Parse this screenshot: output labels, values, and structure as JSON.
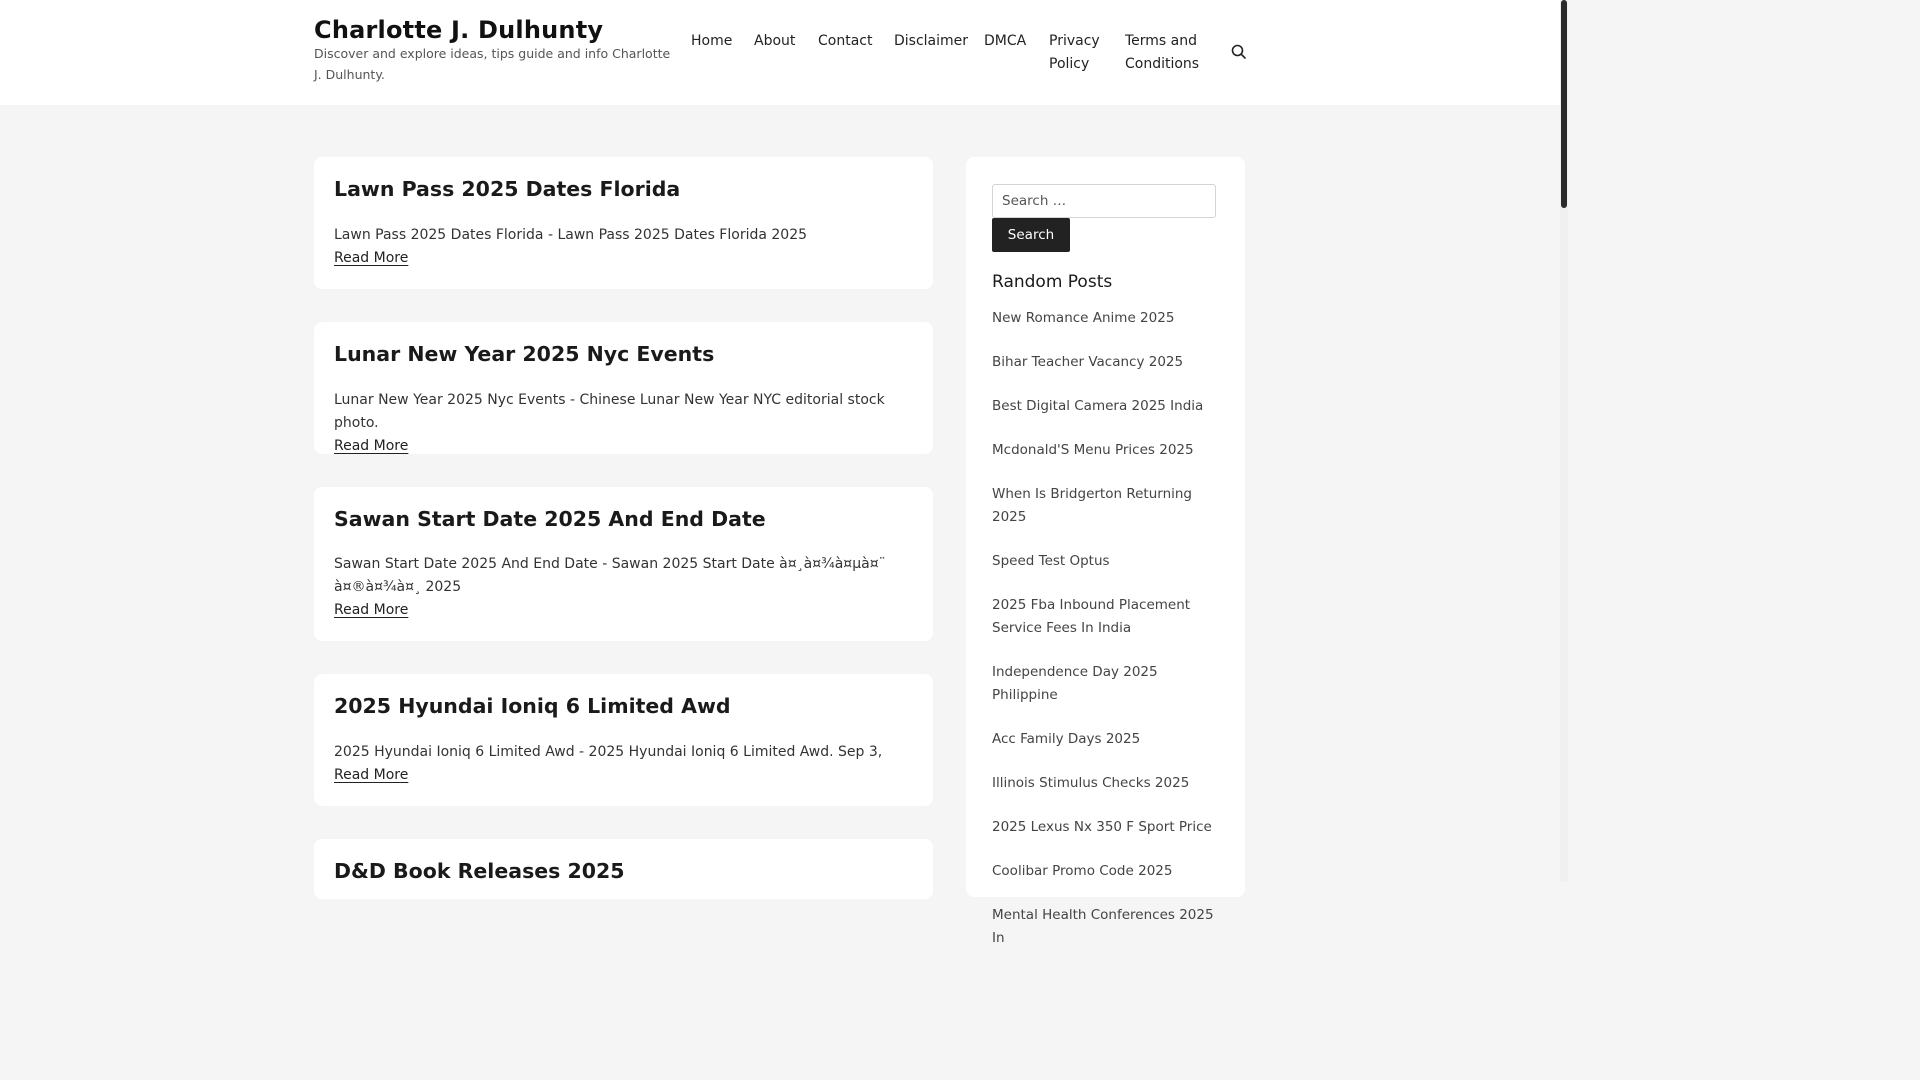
{
  "header": {
    "site_title": "Charlotte J. Dulhunty",
    "site_description": "Discover and explore ideas, tips guide and info Charlotte J. Dulhunty.",
    "nav": [
      "Home",
      "About",
      "Contact",
      "Disclaimer",
      "DMCA",
      "Privacy Policy",
      "Terms and Conditions"
    ],
    "search_icon": "search-icon"
  },
  "posts": [
    {
      "title": "Lawn Pass 2025 Dates Florida",
      "excerpt": "Lawn Pass 2025 Dates Florida - Lawn Pass 2025 Dates Florida 2025",
      "read_more": "Read More"
    },
    {
      "title": "Lunar New Year 2025 Nyc Events",
      "excerpt": "Lunar New Year 2025 Nyc Events - Chinese Lunar New Year NYC editorial stock photo.",
      "read_more": "Read More"
    },
    {
      "title": "Sawan Start Date 2025 And End Date",
      "excerpt": "Sawan Start Date 2025 And End Date - Sawan 2025 Start Date à¤¸à¤¾à¤µà¤¨ à¤®à¤¾à¤¸ 2025",
      "read_more": "Read More"
    },
    {
      "title": "2025 Hyundai Ioniq 6 Limited Awd",
      "excerpt": "2025 Hyundai Ioniq 6 Limited Awd - 2025 Hyundai Ioniq 6 Limited Awd. Sep 3,",
      "read_more": "Read More"
    },
    {
      "title": "D&D Book Releases 2025"
    }
  ],
  "sidebar": {
    "search_placeholder": "Search …",
    "search_button": "Search",
    "random_title": "Random Posts",
    "random_posts": [
      "New Romance Anime 2025",
      "Bihar Teacher Vacancy 2025",
      "Best Digital Camera 2025 India",
      "Mcdonald'S Menu Prices 2025",
      "When Is Bridgerton Returning 2025",
      "Speed Test Optus",
      "2025 Fba Inbound Placement Service Fees In India",
      "Independence Day 2025 Philippine",
      "Acc Family Days 2025",
      "Illinois Stimulus Checks 2025",
      "2025 Lexus Nx 350 F Sport Price",
      "Coolibar Promo Code 2025",
      "Mental Health Conferences 2025 In"
    ]
  }
}
